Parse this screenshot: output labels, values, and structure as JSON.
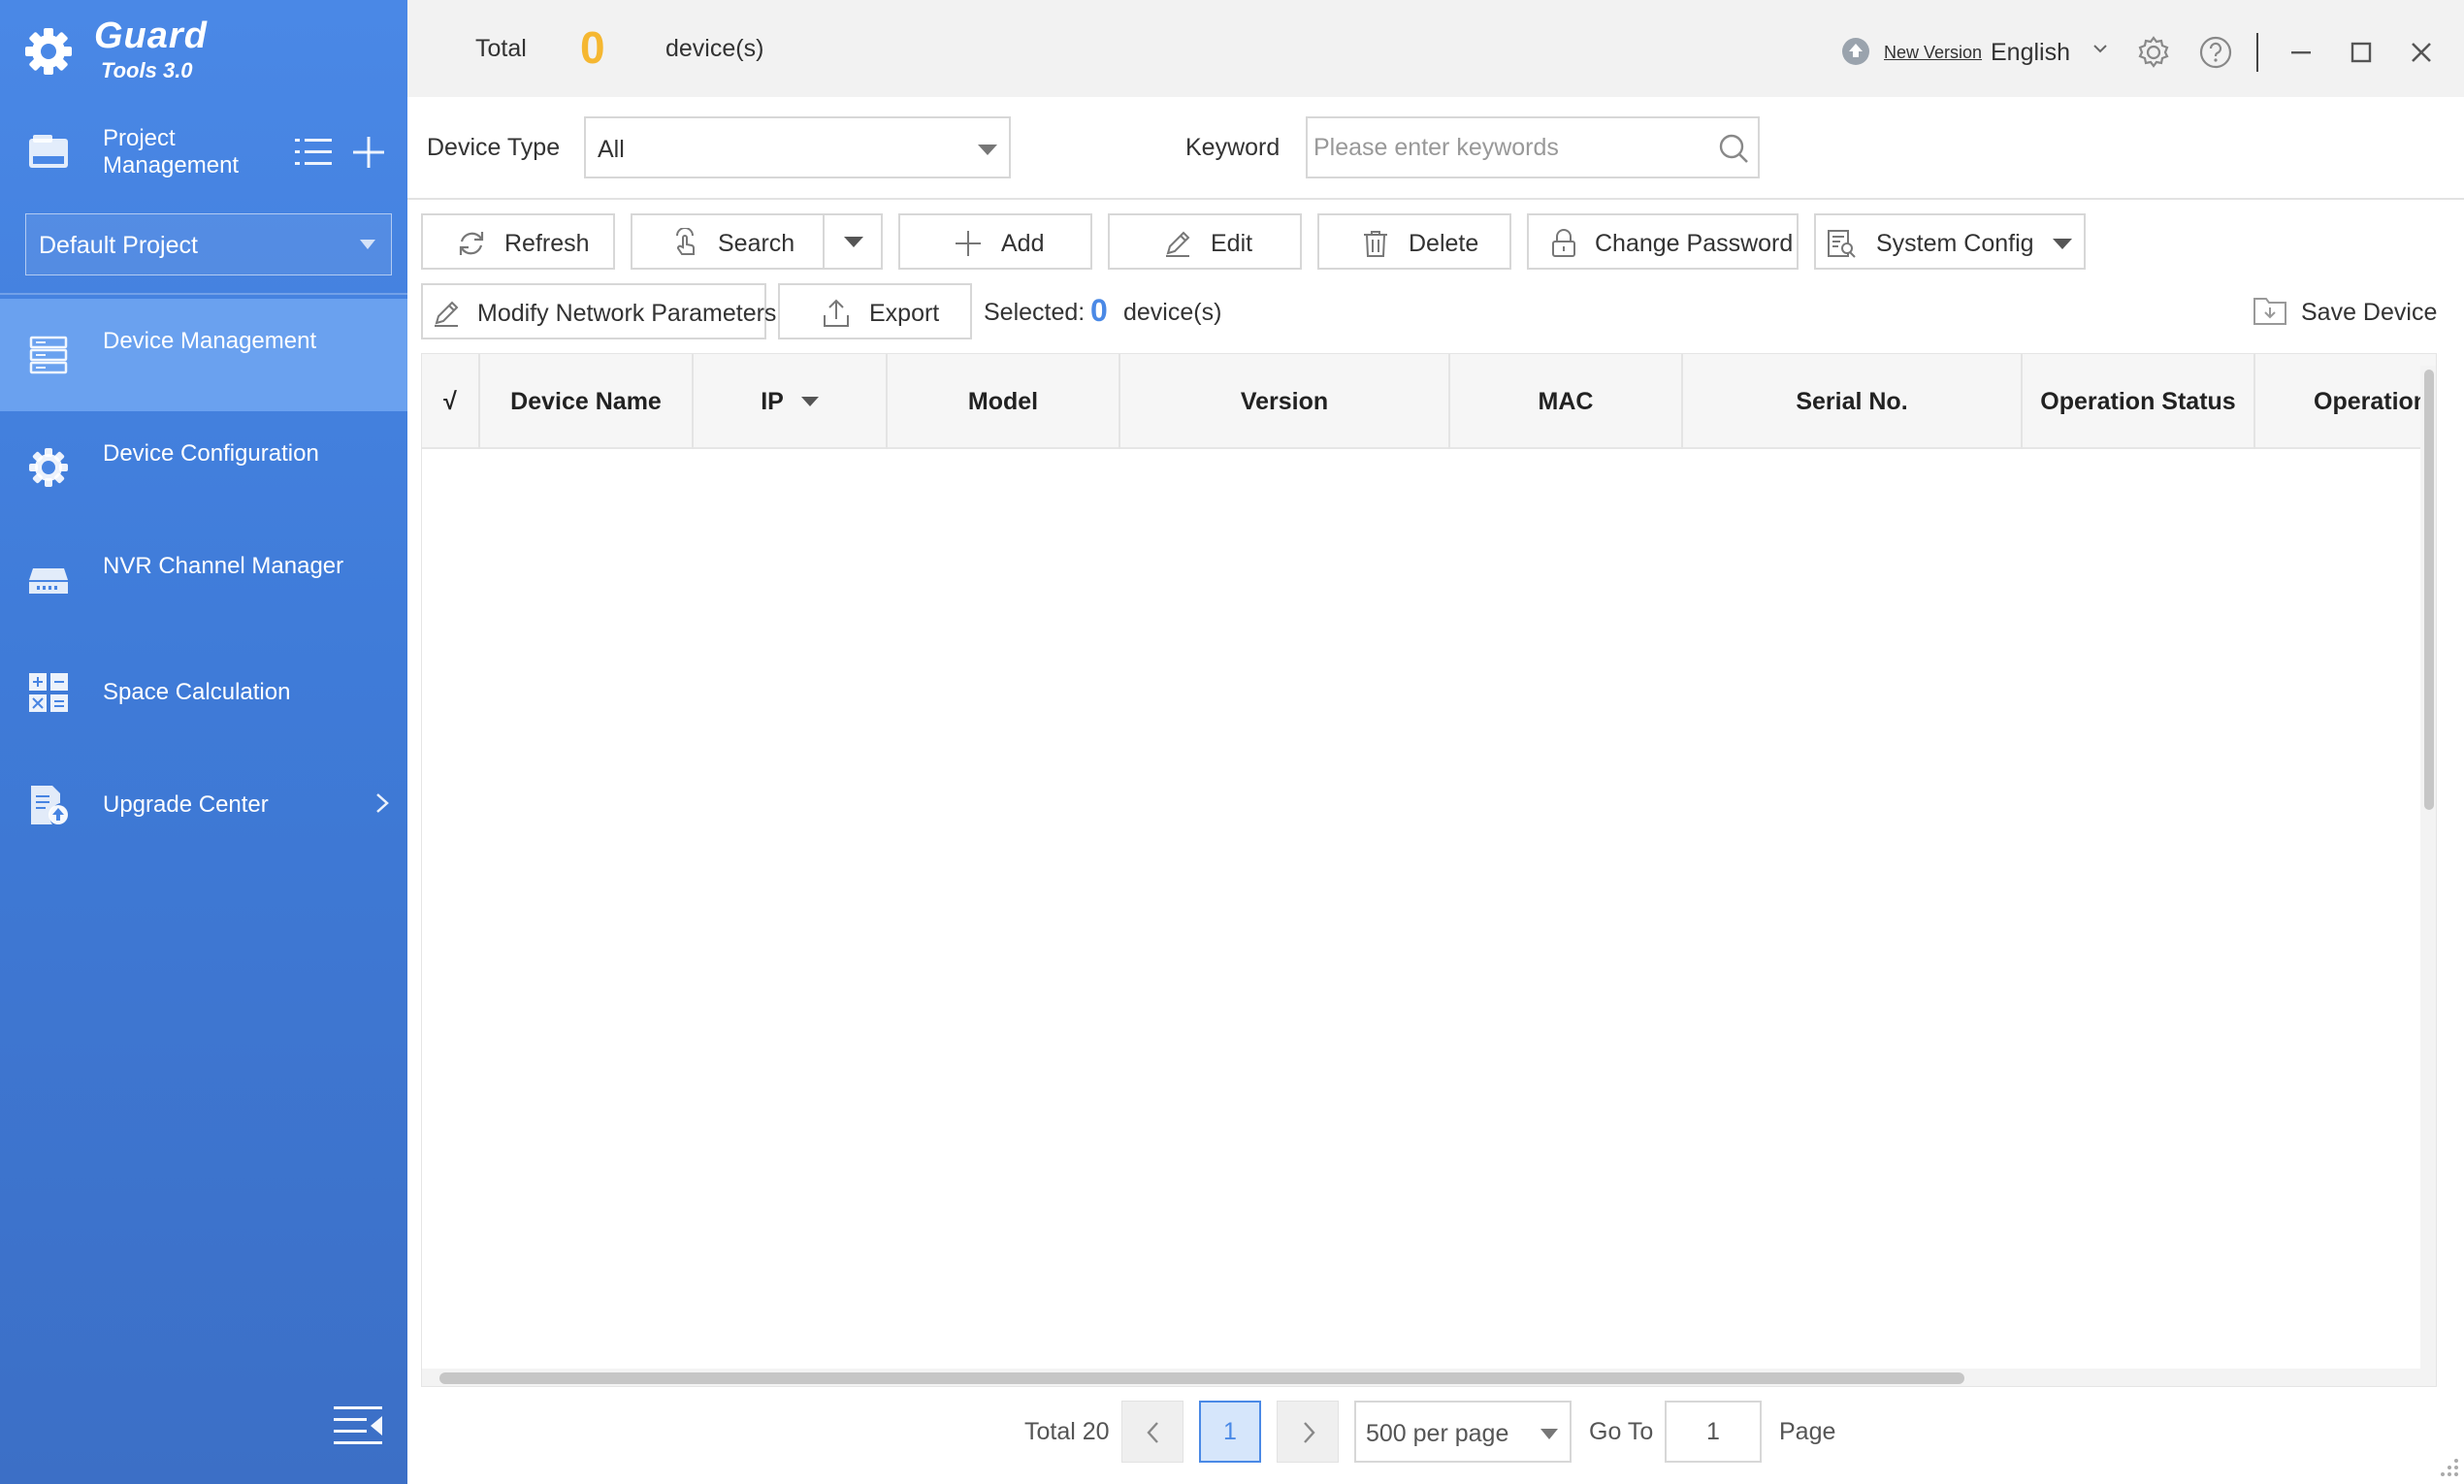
{
  "brand": {
    "title": "Guard",
    "subtitle": "Tools 3.0"
  },
  "sidebar": {
    "project_label": "Project Management",
    "project_select": "Default Project",
    "items": [
      {
        "label": "Device Management",
        "icon": "server-icon",
        "active": true
      },
      {
        "label": "Device Configuration",
        "icon": "gear-icon",
        "active": false
      },
      {
        "label": "NVR Channel Manager",
        "icon": "nvr-icon",
        "active": false
      },
      {
        "label": "Space Calculation",
        "icon": "calculator-icon",
        "active": false
      },
      {
        "label": "Upgrade Center",
        "icon": "upgrade-icon",
        "active": false
      }
    ]
  },
  "topbar": {
    "total_label": "Total",
    "total_count": "0",
    "total_unit": "device(s)",
    "new_version": "New Version",
    "language": "English"
  },
  "filters": {
    "device_type_label": "Device Type",
    "device_type_value": "All",
    "keyword_label": "Keyword",
    "keyword_placeholder": "Please enter keywords"
  },
  "toolbar": {
    "refresh": "Refresh",
    "search": "Search",
    "add": "Add",
    "edit": "Edit",
    "delete": "Delete",
    "change_password": "Change Password",
    "system_config": "System Config",
    "modify_network": "Modify Network Parameters",
    "export": "Export",
    "selected_label": "Selected:",
    "selected_count": "0",
    "selected_unit": "device(s)",
    "save_device": "Save Device"
  },
  "table": {
    "columns": [
      "√",
      "Device Name",
      "IP",
      "Model",
      "Version",
      "MAC",
      "Serial No.",
      "Operation Status",
      "Operation"
    ],
    "rows": []
  },
  "pagination": {
    "total": "Total 20",
    "current_page": "1",
    "page_size": "500 per page",
    "goto_label": "Go To",
    "goto_value": "1",
    "page_label": "Page"
  },
  "colors": {
    "sidebar": "#4a88e6",
    "active": "#6aa1ef",
    "accent": "#4a89e6",
    "count": "#f5b731"
  }
}
